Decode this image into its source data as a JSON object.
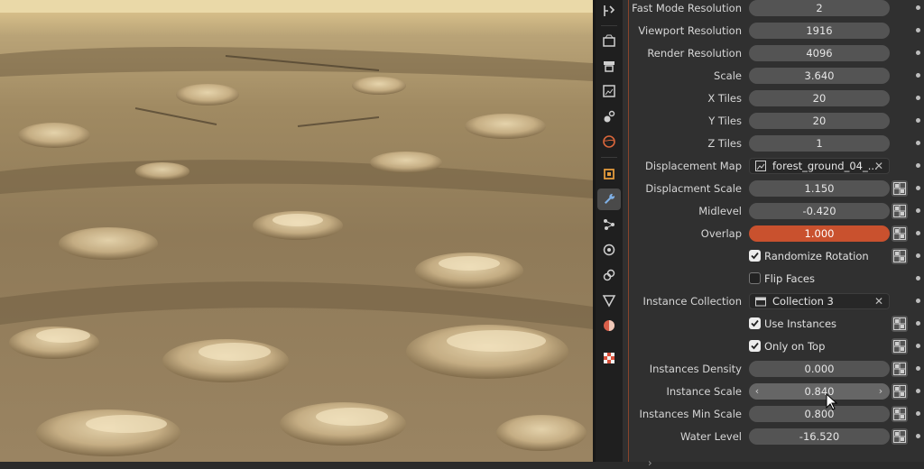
{
  "properties": {
    "rows": [
      {
        "label": "Fast Mode Resolution",
        "value": "2",
        "kind": "number"
      },
      {
        "label": "Viewport Resolution",
        "value": "1916",
        "kind": "number"
      },
      {
        "label": "Render Resolution",
        "value": "4096",
        "kind": "number"
      },
      {
        "label": "Scale",
        "value": "3.640",
        "kind": "number"
      },
      {
        "label": "X Tiles",
        "value": "20",
        "kind": "number"
      },
      {
        "label": "Y Tiles",
        "value": "20",
        "kind": "number"
      },
      {
        "label": "Z Tiles",
        "value": "1",
        "kind": "number"
      },
      {
        "label": "Displacement Map",
        "value": "forest_ground_04_...",
        "kind": "image-pointer"
      },
      {
        "label": "Displacment Scale",
        "value": "1.150",
        "kind": "number"
      },
      {
        "label": "Midlevel",
        "value": "-0.420",
        "kind": "number"
      },
      {
        "label": "Overlap",
        "value": "1.000",
        "kind": "number-active"
      },
      {
        "label": "",
        "value": "Randomize Rotation",
        "kind": "checkbox",
        "checked": true
      },
      {
        "label": "",
        "value": "Flip Faces",
        "kind": "checkbox",
        "checked": false
      },
      {
        "label": "Instance Collection",
        "value": "Collection 3",
        "kind": "collection-pointer"
      },
      {
        "label": "",
        "value": "Use Instances",
        "kind": "checkbox",
        "checked": true
      },
      {
        "label": "",
        "value": "Only on Top",
        "kind": "checkbox",
        "checked": true
      },
      {
        "label": "Instances Density",
        "value": "0.000",
        "kind": "number"
      },
      {
        "label": "Instance Scale",
        "value": "0.840",
        "kind": "number-hover"
      },
      {
        "label": "Instances Min Scale",
        "value": "0.800",
        "kind": "number"
      },
      {
        "label": "Water Level",
        "value": "-16.520",
        "kind": "number"
      }
    ]
  },
  "tabs": [
    {
      "name": "tool-icon"
    },
    {
      "name": "render-icon"
    },
    {
      "name": "output-icon"
    },
    {
      "name": "view-layer-icon"
    },
    {
      "name": "scene-icon"
    },
    {
      "name": "world-icon"
    },
    {
      "name": "object-icon"
    },
    {
      "name": "modifier-wrench-icon",
      "active": true
    },
    {
      "name": "particles-icon"
    },
    {
      "name": "physics-icon"
    },
    {
      "name": "constraints-icon"
    },
    {
      "name": "data-icon"
    },
    {
      "name": "material-icon"
    },
    {
      "name": "texture-icon"
    }
  ],
  "colors": {
    "accent": "#c9512e",
    "panel": "#303030",
    "field": "#545454"
  }
}
